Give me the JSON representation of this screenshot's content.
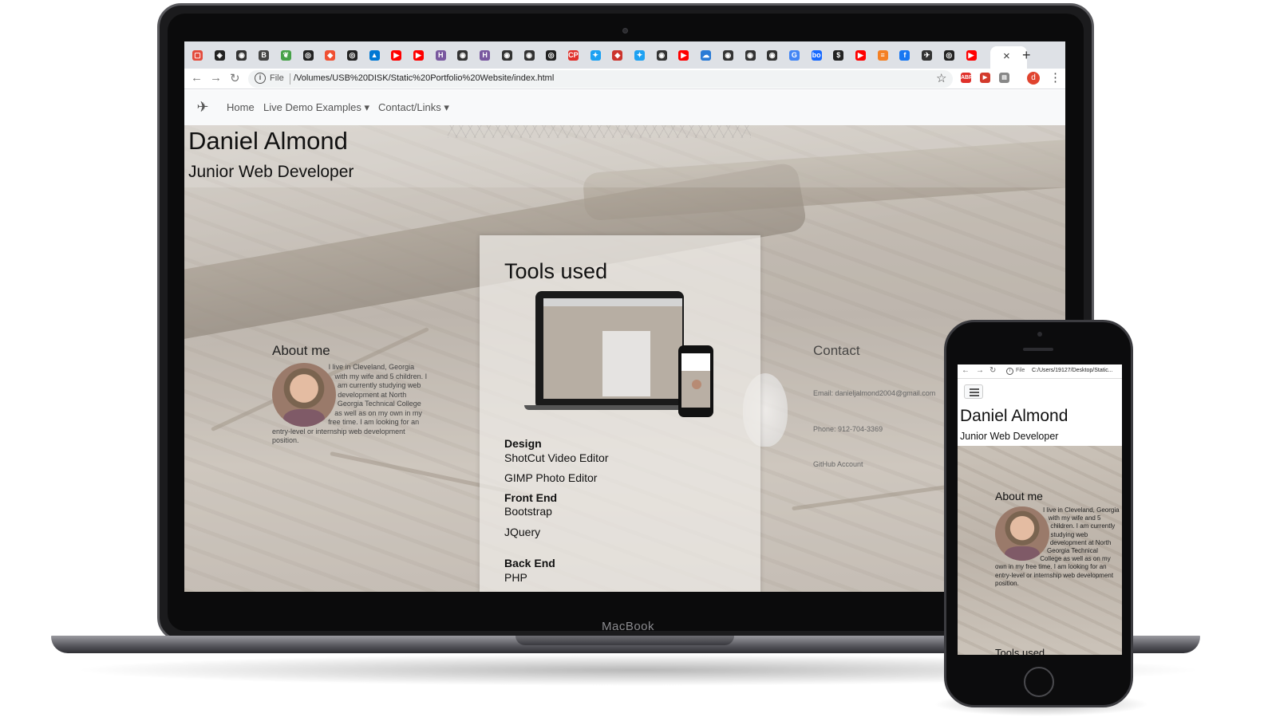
{
  "device_label": "MacBook",
  "browser": {
    "tabs": [
      {
        "icon": "pocket-icon",
        "color": "#e34b3c",
        "glyph": "▢"
      },
      {
        "icon": "codepen-icon",
        "color": "#222222",
        "glyph": "◈"
      },
      {
        "icon": "chrome-icon",
        "color": "#333333",
        "glyph": "◉"
      },
      {
        "icon": "bootstrap-icon",
        "color": "#444444",
        "glyph": "B"
      },
      {
        "icon": "mongodb-icon",
        "color": "#47a248",
        "glyph": "❦"
      },
      {
        "icon": "github-icon",
        "color": "#222222",
        "glyph": "◎"
      },
      {
        "icon": "git-icon",
        "color": "#f05032",
        "glyph": "◆"
      },
      {
        "icon": "github-icon",
        "color": "#222222",
        "glyph": "◎"
      },
      {
        "icon": "azure-icon",
        "color": "#0078d4",
        "glyph": "▲"
      },
      {
        "icon": "youtube-icon",
        "color": "#ff0000",
        "glyph": "▶"
      },
      {
        "icon": "youtube-icon",
        "color": "#ff0000",
        "glyph": "▶"
      },
      {
        "icon": "heroku-icon",
        "color": "#79589f",
        "glyph": "H"
      },
      {
        "icon": "chrome-icon",
        "color": "#333333",
        "glyph": "◉"
      },
      {
        "icon": "heroku-icon",
        "color": "#79589f",
        "glyph": "H"
      },
      {
        "icon": "chrome-icon",
        "color": "#333333",
        "glyph": "◉"
      },
      {
        "icon": "chrome-icon",
        "color": "#333333",
        "glyph": "◉"
      },
      {
        "icon": "github-icon",
        "color": "#222222",
        "glyph": "◎"
      },
      {
        "icon": "codepen-red-icon",
        "color": "#e0302a",
        "glyph": "CP"
      },
      {
        "icon": "twitter-icon",
        "color": "#1da1f2",
        "glyph": "✦"
      },
      {
        "icon": "ruby-icon",
        "color": "#cc342d",
        "glyph": "◆"
      },
      {
        "icon": "twitter-icon",
        "color": "#1da1f2",
        "glyph": "✦"
      },
      {
        "icon": "chrome-icon",
        "color": "#333333",
        "glyph": "◉"
      },
      {
        "icon": "youtube-icon",
        "color": "#ff0000",
        "glyph": "▶"
      },
      {
        "icon": "cloud-icon",
        "color": "#2a7bd6",
        "glyph": "☁"
      },
      {
        "icon": "chrome-icon",
        "color": "#333333",
        "glyph": "◉"
      },
      {
        "icon": "chrome-icon",
        "color": "#333333",
        "glyph": "◉"
      },
      {
        "icon": "chrome-icon",
        "color": "#333333",
        "glyph": "◉"
      },
      {
        "icon": "google-icon",
        "color": "#4285f4",
        "glyph": "G"
      },
      {
        "icon": "behance-icon",
        "color": "#1769ff",
        "glyph": "bo"
      },
      {
        "icon": "bank-icon",
        "color": "#222222",
        "glyph": "$"
      },
      {
        "icon": "youtube-icon",
        "color": "#ff0000",
        "glyph": "▶"
      },
      {
        "icon": "stackoverflow-icon",
        "color": "#f48024",
        "glyph": "≡"
      },
      {
        "icon": "facebook-icon",
        "color": "#1877f2",
        "glyph": "f"
      },
      {
        "icon": "site-icon",
        "color": "#333333",
        "glyph": "✈"
      },
      {
        "icon": "github-icon",
        "color": "#222222",
        "glyph": "◎"
      },
      {
        "icon": "youtube-icon",
        "color": "#ff0000",
        "glyph": "▶"
      }
    ],
    "close_glyph": "×",
    "new_tab_glyph": "+",
    "address": {
      "scheme_label": "File",
      "url": "/Volumes/USB%20DISK/Static%20Portfolio%20Website/index.html"
    },
    "extensions": [
      {
        "icon": "adblock-icon",
        "color": "#e0302a",
        "glyph": "ABP"
      },
      {
        "icon": "video-ext-icon",
        "color": "#d33a2c",
        "glyph": "▶"
      },
      {
        "icon": "elements-ext-icon",
        "color": "#888888",
        "glyph": "▤"
      }
    ],
    "profile_initial": "d"
  },
  "site": {
    "nav": {
      "home": "Home",
      "live_demo": "Live Demo Examples",
      "contact_links": "Contact/Links"
    },
    "name": "Daniel Almond",
    "title": "Junior Web Developer",
    "about": {
      "heading": "About me",
      "text": "I live in Cleveland, Georgia with my wife and 5 children. I am currently studying web development at North Georgia Technical College as well as on my own in my free time. I am looking for an entry-level or internship web development position."
    },
    "tools": {
      "heading": "Tools used",
      "design_label": "Design",
      "design_items": [
        "ShotCut Video Editor",
        "GIMP Photo Editor"
      ],
      "frontend_label": "Front End",
      "frontend_items": [
        "Bootstrap",
        "JQuery"
      ],
      "backend_label": "Back End",
      "backend_items": [
        "PHP"
      ]
    },
    "contact": {
      "heading": "Contact",
      "email": "Email: danieljalmond2004@gmail.com",
      "phone": "Phone: 912-704-3369",
      "github": "GitHub Account"
    }
  },
  "phone": {
    "scheme_label": "File",
    "url": "C:/Users/19127/Desktop/Static...",
    "name": "Daniel Almond",
    "title": "Junior Web Developer",
    "about_heading": "About me",
    "about_text": "I live in Cleveland, Georgia with my wife and 5 children. I am currently studying web development at North Georgia Technical College as well as on my own in my free time. I am looking for an entry-level or internship web development position.",
    "tools_heading": "Tools used"
  }
}
